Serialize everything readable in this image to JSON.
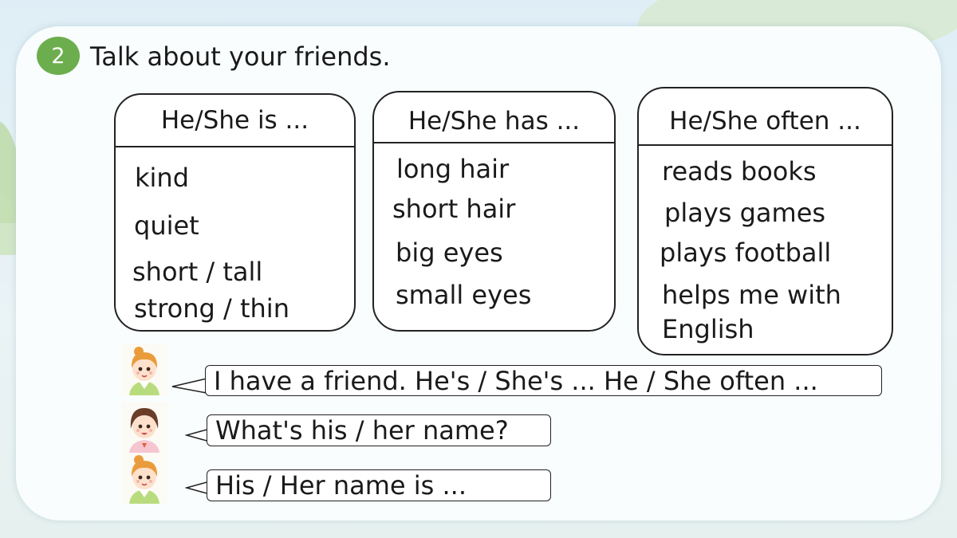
{
  "exercise": {
    "number": "2",
    "instruction": "Talk about your friends."
  },
  "boxes": [
    {
      "title": "He/She is ...",
      "items": [
        "kind",
        "quiet",
        "short / tall",
        "strong / thin"
      ]
    },
    {
      "title": "He/She has ...",
      "items": [
        "long hair",
        "short hair",
        "big eyes",
        "small eyes"
      ]
    },
    {
      "title": "He/She often ...",
      "items": [
        "reads books",
        "plays games",
        "plays football",
        "helps me with",
        "English"
      ]
    }
  ],
  "dialogue": [
    {
      "speaker": "girl-1",
      "text": "I have a friend. He's / She's ... He / She often ..."
    },
    {
      "speaker": "girl-2",
      "text": "What's his / her name?"
    },
    {
      "speaker": "girl-1",
      "text": "His / Her name is ..."
    }
  ],
  "colors": {
    "badge": "#6cae4d",
    "panel": "#f9fdfd",
    "background": "#e3f0f5"
  }
}
